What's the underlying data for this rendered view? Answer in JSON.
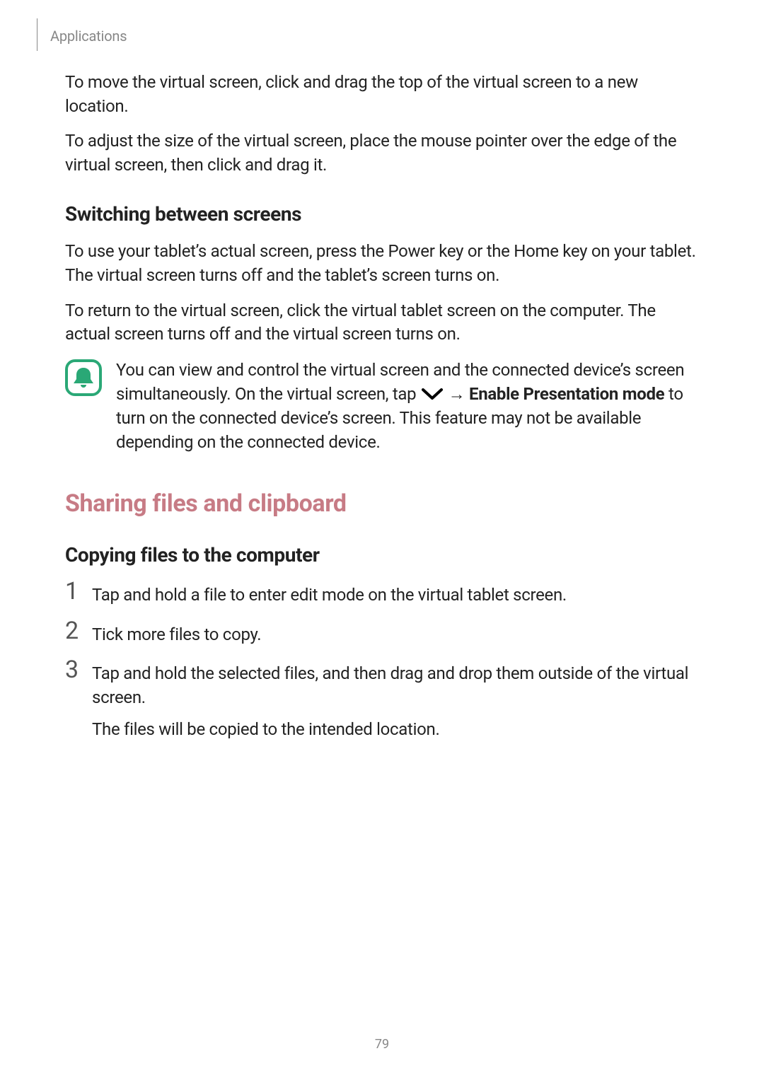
{
  "header": {
    "section": "Applications"
  },
  "body": {
    "p1": "To move the virtual screen, click and drag the top of the virtual screen to a new location.",
    "p2": "To adjust the size of the virtual screen, place the mouse pointer over the edge of the virtual screen, then click and drag it.",
    "h3a": "Switching between screens",
    "p3": "To use your tablet’s actual screen, press the Power key or the Home key on your tablet. The virtual screen turns off and the tablet’s screen turns on.",
    "p4": "To return to the virtual screen, click the virtual tablet screen on the computer. The actual screen turns off and the virtual screen turns on.",
    "note": {
      "pre": "You can view and control the virtual screen and the connected device’s screen simultaneously. On the virtual screen, tap ",
      "arrow": " → ",
      "bold": "Enable Presentation mode",
      "post": " to turn on the connected device’s screen. This feature may not be available depending on the connected device."
    },
    "h2": "Sharing files and clipboard",
    "h3b": "Copying files to the computer",
    "steps": {
      "n1": "1",
      "s1": "Tap and hold a file to enter edit mode on the virtual tablet screen.",
      "n2": "2",
      "s2": "Tick more files to copy.",
      "n3": "3",
      "s3a": "Tap and hold the selected files, and then drag and drop them outside of the virtual screen.",
      "s3b": "The files will be copied to the intended location."
    }
  },
  "page": "79"
}
